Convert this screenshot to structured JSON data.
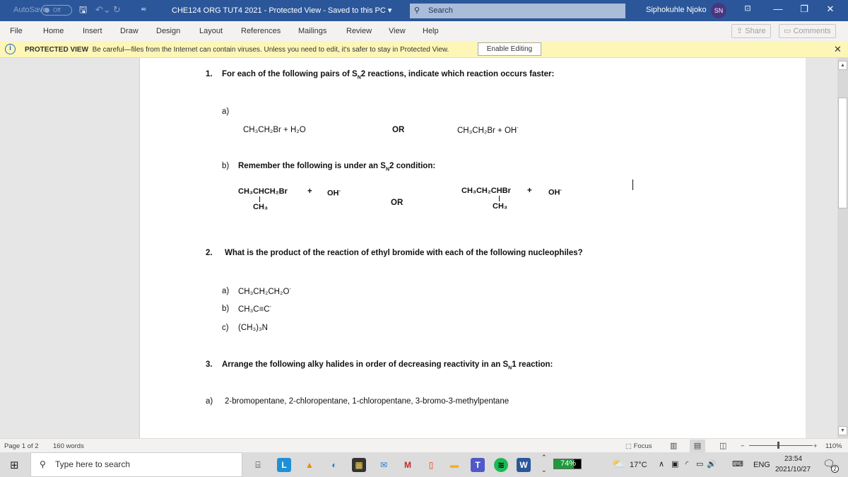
{
  "titlebar": {
    "autosave_label": "AutoSave",
    "autosave_state": "Off",
    "doc_title": "CHE124 ORG TUT4 2021  -  Protected View  -  Saved to this PC  ▾",
    "search_placeholder": "Search",
    "user_name": "Siphokuhle Njoko",
    "user_initials": "SN"
  },
  "menu": {
    "items": [
      "File",
      "Home",
      "Insert",
      "Draw",
      "Design",
      "Layout",
      "References",
      "Mailings",
      "Review",
      "View",
      "Help"
    ],
    "share_label": "Share",
    "comments_label": "Comments"
  },
  "protected_view": {
    "title": "PROTECTED VIEW",
    "message": "Be careful—files from the Internet can contain viruses. Unless you need to edit, it's safer to stay in Protected View.",
    "enable_button": "Enable Editing"
  },
  "document": {
    "q1": {
      "num": "1.",
      "text_pre": "For each of the following pairs of S",
      "sub": "N",
      "text_post": "2 reactions, indicate which reaction occurs faster:"
    },
    "q1a": {
      "label": "a)",
      "left": "CH₃CH₂Br  +  H₂O",
      "or": "OR",
      "right": "CH₃CH₂Br  +  OH"
    },
    "q1b": {
      "label": "b)",
      "text_pre": "Remember the following is under an S",
      "sub": "N",
      "text_post": "2 condition:",
      "left_main": "CH₃CHCH₂Br",
      "left_branch": "CH₃",
      "left_plus": "+",
      "left_nuc": "OH",
      "or": "OR",
      "right_main": "CH₃CH₂CHBr",
      "right_branch": "CH₃",
      "right_plus": "+",
      "right_nuc": "OH"
    },
    "q2": {
      "num": "2.",
      "text": "What is the product of the reaction of ethyl bromide with each of the following nucleophiles?",
      "items": [
        {
          "label": "a)",
          "text": "CH₃CH₂CH₂O"
        },
        {
          "label": "b)",
          "text": "CH₃C≡C"
        },
        {
          "label": "c)",
          "text": "(CH₃)₃N"
        }
      ]
    },
    "q3": {
      "num": "3.",
      "text_pre": "Arrange the following alky halides in order of decreasing reactivity in an S",
      "sub": "N",
      "text_post": "1 reaction:",
      "a_label": "a)",
      "a_text": "2-bromopentane, 2-chloropentane, 1-chloropentane, 3-bromo-3-methylpentane"
    }
  },
  "status": {
    "page": "Page 1 of 2",
    "words": "160 words",
    "focus": "Focus",
    "zoom": "110%"
  },
  "taskbar": {
    "search_placeholder": "Type here to search",
    "battery_percent": 74,
    "battery_label": "74%",
    "temperature": "17°C",
    "language": "ENG",
    "time": "23:54",
    "date": "2021/10/27",
    "notification_count": "2"
  }
}
